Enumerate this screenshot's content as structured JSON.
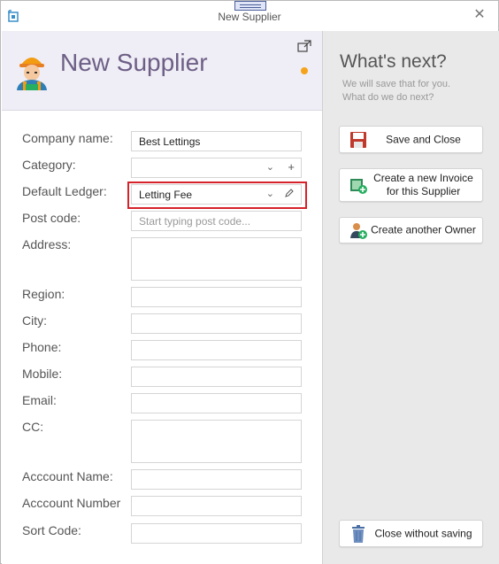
{
  "window": {
    "title": "New Supplier",
    "close_symbol": "✕"
  },
  "header": {
    "title": "New Supplier"
  },
  "form": {
    "company_name": {
      "label": "Company name:",
      "value": "Best Lettings"
    },
    "category": {
      "label": "Category:",
      "value": ""
    },
    "default_ledger": {
      "label": "Default Ledger:",
      "value": "Letting Fee"
    },
    "post_code": {
      "label": "Post code:",
      "placeholder": "Start typing post code..."
    },
    "address": {
      "label": "Address:"
    },
    "region": {
      "label": "Region:"
    },
    "city": {
      "label": "City:"
    },
    "phone": {
      "label": "Phone:"
    },
    "mobile": {
      "label": "Mobile:"
    },
    "email": {
      "label": "Email:"
    },
    "cc": {
      "label": "CC:"
    },
    "account_name": {
      "label": "Acccount Name:"
    },
    "account_number": {
      "label": "Acccount Number"
    },
    "sort_code": {
      "label": "Sort Code:"
    }
  },
  "next": {
    "title": "What's next?",
    "subtitle_1": "We will save that for you.",
    "subtitle_2": "What do we do next?",
    "save_close": "Save and Close",
    "invoice_1": "Create a new Invoice",
    "invoice_2": "for this Supplier",
    "owner": "Create another Owner",
    "close_without": "Close without saving"
  },
  "colors": {
    "accent_header_text": "#6d5f86",
    "highlight": "#d6222a",
    "status_dot": "#f5a31a"
  }
}
